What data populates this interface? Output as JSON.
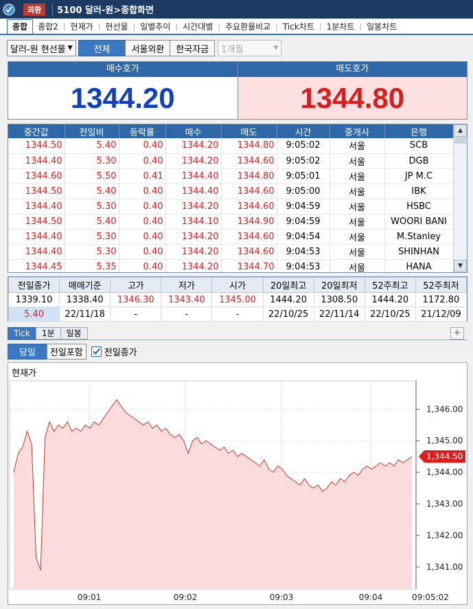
{
  "window": {
    "tag": "외환",
    "title": "5100 달러-원>종합화면"
  },
  "tabs": [
    "종합",
    "종합2",
    "현재가",
    "현선물",
    "일별추이",
    "시간대별",
    "주요환율비교",
    "Tick차트",
    "1분차트",
    "일봉차트"
  ],
  "toolbar": {
    "market_select": "달러-원 현선물",
    "segments": [
      "전체",
      "서울외환",
      "한국자금"
    ],
    "period_select": "1개월"
  },
  "quote": {
    "bid_label": "매수호가",
    "bid_value": "1344.20",
    "ask_label": "매도호가",
    "ask_value": "1344.80",
    "colors": {
      "bid": "#1040c0",
      "ask": "#d81e1e",
      "ask_bg": "#fde0e0"
    }
  },
  "ticks": {
    "headers": [
      "중간값",
      "전일비",
      "등락률",
      "매수",
      "매도",
      "시간",
      "중개사",
      "은행"
    ],
    "rows": [
      [
        "1344.50",
        "5.40",
        "0.40",
        "1344.20",
        "1344.80",
        "9:05:02",
        "서울",
        "SCB"
      ],
      [
        "1344.40",
        "5.30",
        "0.40",
        "1344.20",
        "1344.60",
        "9:05:02",
        "서울",
        "DGB"
      ],
      [
        "1344.60",
        "5.50",
        "0.41",
        "1344.40",
        "1344.80",
        "9:05:01",
        "서울",
        "JP M.C"
      ],
      [
        "1344.50",
        "5.40",
        "0.40",
        "1344.40",
        "1344.60",
        "9:05:00",
        "서울",
        "IBK"
      ],
      [
        "1344.40",
        "5.30",
        "0.40",
        "1344.20",
        "1344.60",
        "9:04:59",
        "서울",
        "HSBC"
      ],
      [
        "1344.50",
        "5.40",
        "0.40",
        "1344.10",
        "1344.90",
        "9:04:59",
        "서울",
        "WOORI BANI"
      ],
      [
        "1344.40",
        "5.30",
        "0.40",
        "1344.20",
        "1344.60",
        "9:04:54",
        "서울",
        "M.Stanley"
      ],
      [
        "1344.40",
        "5.30",
        "0.40",
        "1344.20",
        "1344.60",
        "9:04:53",
        "서울",
        "SHINHAN"
      ],
      [
        "1344.45",
        "5.35",
        "0.40",
        "1344.20",
        "1344.70",
        "9:04:53",
        "서울",
        "HANA"
      ]
    ]
  },
  "summary": {
    "headers": [
      "전일종가",
      "매매기준",
      "고가",
      "저가",
      "시가",
      "20일최고",
      "20일최저",
      "52주최고",
      "52주최저"
    ],
    "row1": [
      "1339.10",
      "1338.40",
      "1346.30",
      "1343.40",
      "1345.00",
      "1444.20",
      "1308.50",
      "1444.20",
      "1172.80"
    ],
    "row2": [
      "5.40",
      "22/11/18",
      "-",
      "-",
      "-",
      "22/10/25",
      "22/11/14",
      "22/10/25",
      "21/12/09"
    ]
  },
  "chart_tabs": [
    "Tick",
    "1분",
    "일봉"
  ],
  "chart_options": {
    "today": "당일",
    "include_prev": "전일포함",
    "prev_close_check": "전일종가"
  },
  "chart_data": {
    "type": "area",
    "title": "현재가",
    "x_time_labels": [
      "09:01",
      "09:02",
      "09:03",
      "09:04",
      "09:05:02"
    ],
    "y_ticks": [
      1341.0,
      1342.0,
      1343.0,
      1344.0,
      1345.0,
      1346.0
    ],
    "y_tick_labels": [
      "1,341.00",
      "1,342.00",
      "1,343.00",
      "1,344.00",
      "1,345.00",
      "1,346.00"
    ],
    "ylim": [
      1340.3,
      1346.9
    ],
    "current_label": "1,344.50",
    "current_value": 1344.5,
    "series": [
      {
        "values": [
          1344.0,
          1344.6,
          1344.8,
          1345.3,
          1344.9,
          1341.3,
          1340.9,
          1345.1,
          1345.6,
          1345.3,
          1345.5,
          1345.4,
          1345.6,
          1345.3,
          1345.4,
          1345.3,
          1345.5,
          1345.4,
          1345.6,
          1345.5,
          1345.7,
          1345.9,
          1346.1,
          1346.3,
          1346.1,
          1345.9,
          1345.8,
          1345.7,
          1345.6,
          1345.5,
          1345.6,
          1345.4,
          1345.5,
          1345.3,
          1345.4,
          1345.2,
          1345.1,
          1345.2,
          1345.0,
          1344.6,
          1345.0,
          1345.1,
          1344.9,
          1345.0,
          1344.9,
          1344.8,
          1344.7,
          1344.8,
          1344.6,
          1344.7,
          1344.5,
          1344.6,
          1344.5,
          1344.4,
          1344.3,
          1344.2,
          1344.4,
          1344.1,
          1344.0,
          1344.2,
          1344.1,
          1343.9,
          1343.8,
          1343.7,
          1343.6,
          1343.8,
          1343.6,
          1343.5,
          1343.6,
          1343.4,
          1343.5,
          1343.7,
          1343.6,
          1343.8,
          1343.7,
          1343.9,
          1344.0,
          1343.9,
          1344.1,
          1344.2,
          1344.1,
          1344.2,
          1344.3,
          1344.2,
          1344.3,
          1344.2,
          1344.4,
          1344.3,
          1344.4,
          1344.5
        ]
      }
    ]
  }
}
